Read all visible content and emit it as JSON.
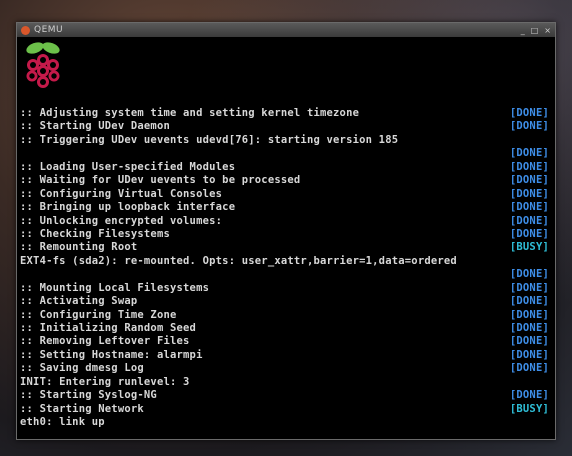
{
  "window": {
    "title": "QEMU",
    "controls": [
      "_",
      "□",
      "×"
    ]
  },
  "console": [
    {
      "text": ":: Adjusting system time and setting kernel timezone",
      "status": "[DONE]"
    },
    {
      "text": ":: Starting UDev Daemon",
      "status": "[DONE]"
    },
    {
      "text": ":: Triggering UDev uevents udevd[76]: starting version 185",
      "status": ""
    },
    {
      "text": "",
      "status": "[DONE]"
    },
    {
      "text": ":: Loading User-specified Modules",
      "status": "[DONE]"
    },
    {
      "text": ":: Waiting for UDev uevents to be processed",
      "status": "[DONE]"
    },
    {
      "text": ":: Configuring Virtual Consoles",
      "status": "[DONE]"
    },
    {
      "text": ":: Bringing up loopback interface",
      "status": "[DONE]"
    },
    {
      "text": ":: Unlocking encrypted volumes:",
      "status": "[DONE]"
    },
    {
      "text": ":: Checking Filesystems",
      "status": "[DONE]"
    },
    {
      "text": ":: Remounting Root",
      "status": "[BUSY]"
    },
    {
      "text": "EXT4-fs (sda2): re-mounted. Opts: user_xattr,barrier=1,data=ordered",
      "status": ""
    },
    {
      "text": "",
      "status": "[DONE]"
    },
    {
      "text": ":: Mounting Local Filesystems",
      "status": "[DONE]"
    },
    {
      "text": ":: Activating Swap",
      "status": "[DONE]"
    },
    {
      "text": ":: Configuring Time Zone",
      "status": "[DONE]"
    },
    {
      "text": ":: Initializing Random Seed",
      "status": "[DONE]"
    },
    {
      "text": ":: Removing Leftover Files",
      "status": "[DONE]"
    },
    {
      "text": ":: Setting Hostname: alarmpi",
      "status": "[DONE]"
    },
    {
      "text": ":: Saving dmesg Log",
      "status": "[DONE]"
    },
    {
      "text": "INIT: Entering runlevel: 3",
      "status": ""
    },
    {
      "text": ":: Starting Syslog-NG",
      "status": "[DONE]"
    },
    {
      "text": ":: Starting Network",
      "status": "[BUSY]"
    },
    {
      "text": "eth0: link up",
      "status": ""
    }
  ],
  "colors": {
    "done": "#3e8ee8",
    "busy": "#2fbfd8",
    "raspberry": "#c51a4a",
    "leaf": "#6cc04a"
  },
  "icons": {
    "app": "qemu-icon",
    "logo": "raspberry-pi-logo"
  }
}
